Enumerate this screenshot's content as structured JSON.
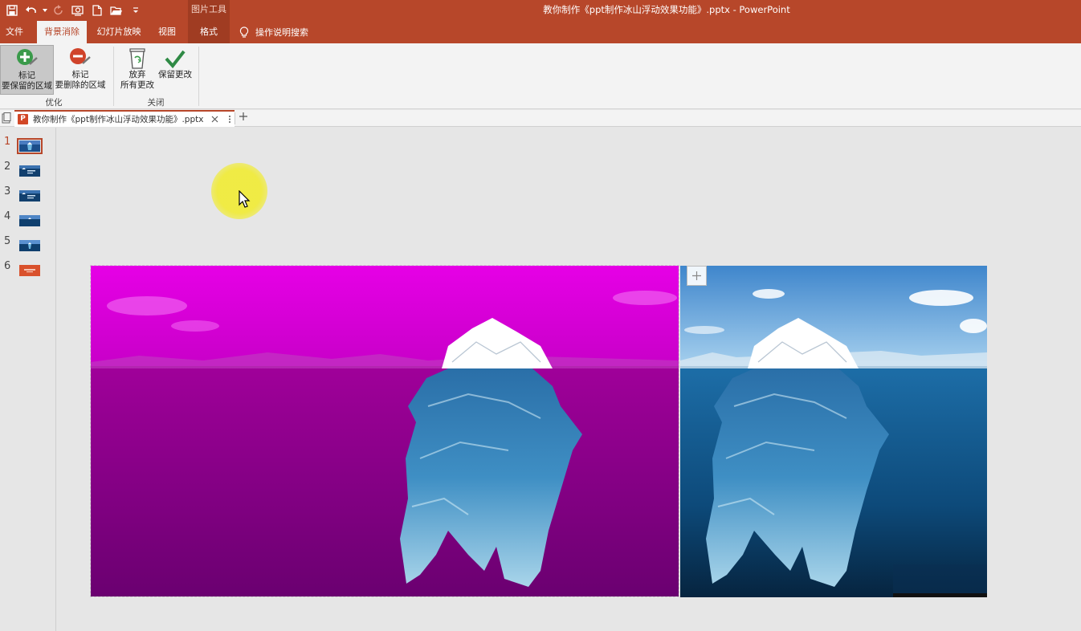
{
  "titlebar": {
    "context_tab_group": "图片工具",
    "document_title": "教你制作《ppt制作冰山浮动效果功能》.pptx  -  PowerPoint"
  },
  "ribbon_tabs": [
    {
      "label": "文件"
    },
    {
      "label": "背景消除"
    },
    {
      "label": "幻灯片放映"
    },
    {
      "label": "视图"
    },
    {
      "label": "格式"
    }
  ],
  "tell_me": "操作说明搜索",
  "ribbon": {
    "mark_keep_line1": "标记",
    "mark_keep_line2": "要保留的区域",
    "mark_remove_line1": "标记",
    "mark_remove_line2": "要删除的区域",
    "group_refine": "优化",
    "discard_line1": "放弃",
    "discard_line2": "所有更改",
    "keep_changes": "保留更改",
    "group_close": "关闭"
  },
  "document_tab": {
    "name": "教你制作《ppt制作冰山浮动效果功能》.pptx"
  },
  "slides": [
    {
      "number": "1",
      "selected": true
    },
    {
      "number": "2"
    },
    {
      "number": "3"
    },
    {
      "number": "4"
    },
    {
      "number": "5"
    },
    {
      "number": "6"
    }
  ],
  "colors": {
    "brand": "#b7472a",
    "removal_overlay": "#d400d4"
  }
}
